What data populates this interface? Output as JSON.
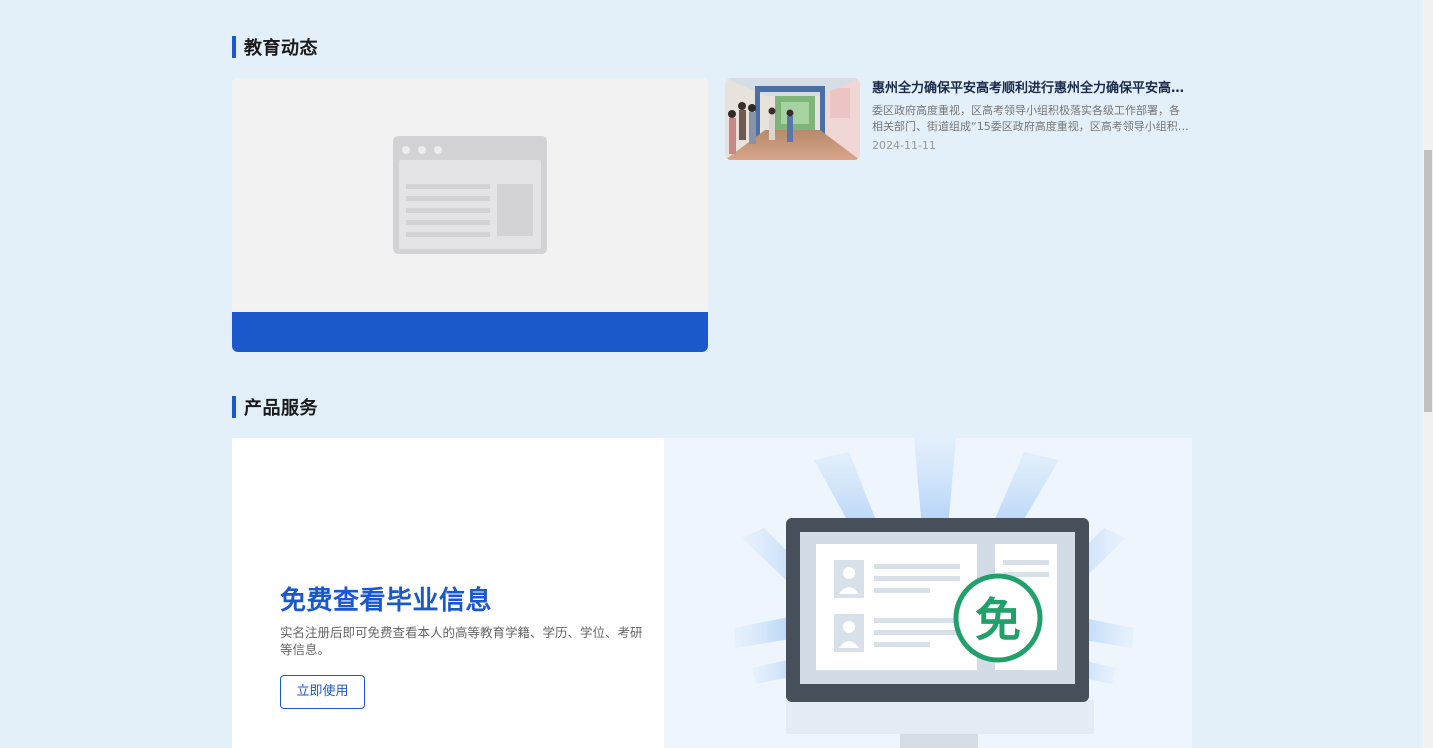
{
  "sections": {
    "news_title": "教育动态",
    "product_title": "产品服务"
  },
  "news": {
    "feature_caption": "",
    "item": {
      "title": "惠州全力确保平安高考顺利进行惠州全力确保平安高考顺利进行",
      "summary": "委区政府高度重视，区高考领导小组积极落实各级工作部署，各相关部门、街道组成“15委区政府高度重视，区高考领导小组积极落实各级工作部署",
      "date": "2024-11-11"
    }
  },
  "product": {
    "heading": "免费查看毕业信息",
    "description": "实名注册后即可免费查看本人的高等教育学籍、学历、学位、考研等信息。",
    "button_label": "立即使用",
    "badge_char": "免"
  },
  "colors": {
    "background": "#e3f0fa",
    "accent": "#1b58cc",
    "badge": "#22a06b",
    "monitor": "#474f5a"
  }
}
